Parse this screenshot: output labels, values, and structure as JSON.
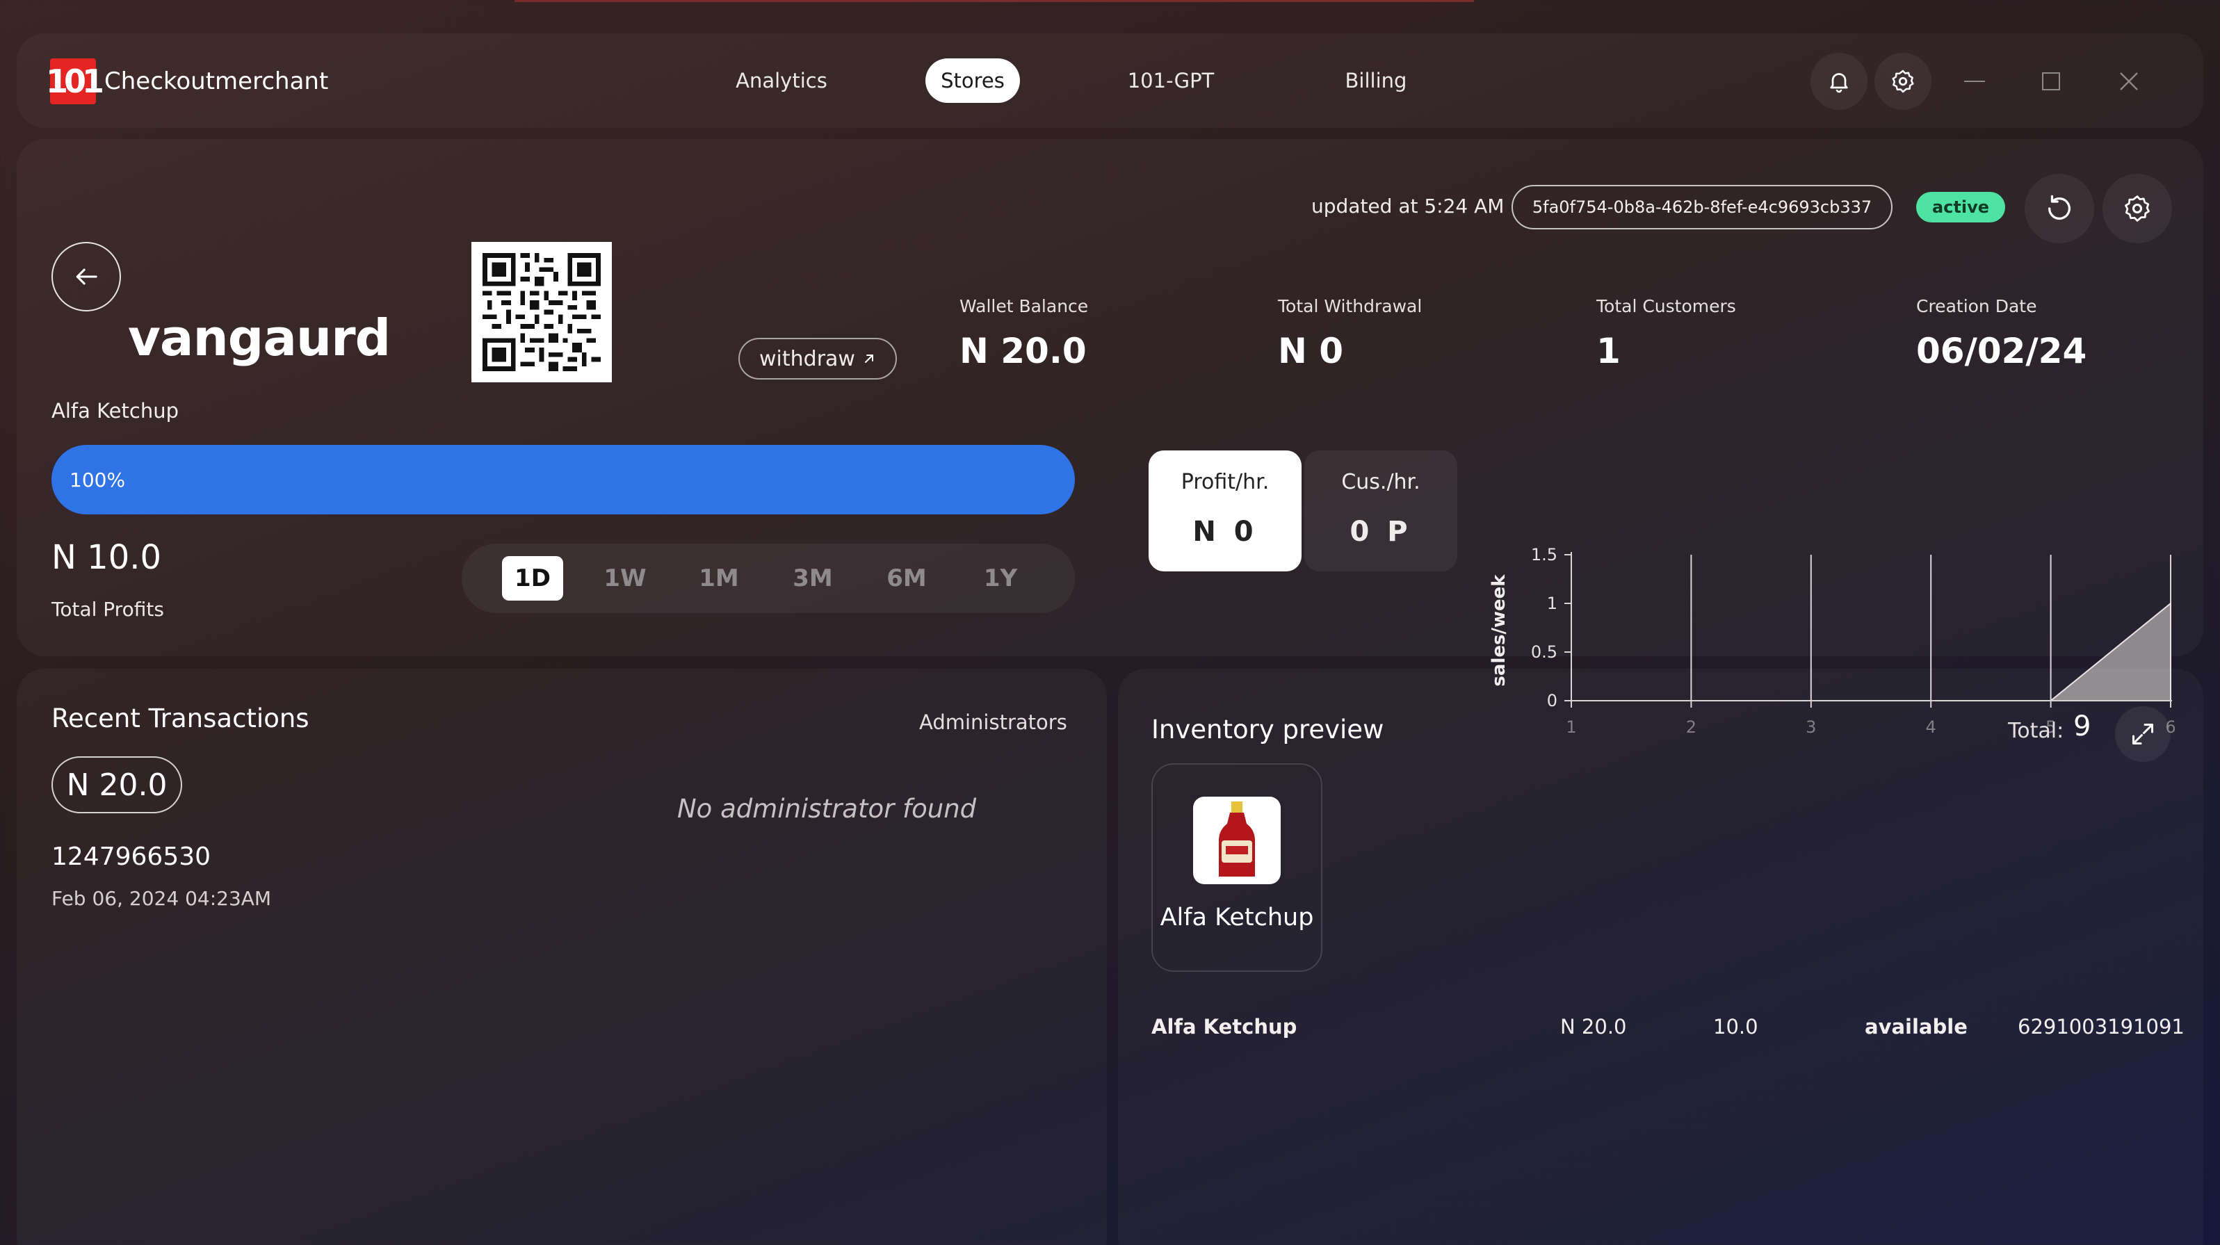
{
  "app": {
    "name": "Checkoutmerchant",
    "logo_text": "101"
  },
  "nav": {
    "items": [
      "Analytics",
      "Stores",
      "101-GPT",
      "Billing"
    ],
    "active": "Stores"
  },
  "store": {
    "name": "vangaurd",
    "product_label": "Alfa Ketchup",
    "withdraw_label": "withdraw",
    "updated_text": "updated at 5:24 AM",
    "store_id": "5fa0f754-0b8a-462b-8fef-e4c9693cb337",
    "status": "active",
    "progress": {
      "percent": 100,
      "label": "100%"
    },
    "profits": {
      "value": "N 10.0",
      "label": "Total Profits"
    },
    "ranges": [
      "1D",
      "1W",
      "1M",
      "3M",
      "6M",
      "1Y"
    ],
    "selected_range": "1D",
    "stats": [
      {
        "label": "Wallet Balance",
        "value": "N 20.0"
      },
      {
        "label": "Total Withdrawal",
        "value": "N 0"
      },
      {
        "label": "Total Customers",
        "value": "1"
      },
      {
        "label": "Creation Date",
        "value": "06/02/24"
      }
    ],
    "per_hour": [
      {
        "label": "Profit/hr.",
        "value": "N 0"
      },
      {
        "label": "Cus./hr.",
        "value": "0 P"
      }
    ]
  },
  "chart_data": {
    "type": "area",
    "x": [
      1,
      2,
      3,
      4,
      5,
      6
    ],
    "series": [
      {
        "values": [
          0,
          0,
          0,
          0,
          0,
          1
        ]
      }
    ],
    "ylabel": "sales/week",
    "xlabel": "",
    "yticks": [
      "0",
      "0.5",
      "1",
      "1.5"
    ],
    "xticks": [
      "1",
      "2",
      "3",
      "4",
      "5",
      "6"
    ],
    "ylim": [
      0,
      1.5
    ],
    "xlim": [
      1,
      6
    ],
    "grid": "vertical",
    "colors": {
      "area": "#8c8a8c",
      "axis": "#d9d4d4"
    }
  },
  "transactions": {
    "title": "Recent Transactions",
    "items": [
      {
        "amount": "N 20.0",
        "id": "1247966530",
        "date": "Feb 06, 2024 04:23AM"
      }
    ]
  },
  "administrators": {
    "title": "Administrators",
    "empty_text": "No administrator found"
  },
  "inventory": {
    "title": "Inventory preview",
    "total_label": "Total:",
    "total": "9",
    "cards": [
      {
        "name": "Alfa Ketchup"
      }
    ],
    "rows": [
      {
        "name": "Alfa Ketchup",
        "price": "N 20.0",
        "quantity": "10.0",
        "status": "available",
        "barcode": "6291003191091"
      }
    ]
  },
  "colors": {
    "accent": "#2f73e6",
    "status": "#4ee3a2",
    "logo": "#e52424"
  },
  "icons": [
    "bell-icon",
    "gear-icon",
    "minimize-icon",
    "maximize-icon",
    "close-icon",
    "back-arrow-icon",
    "refresh-icon",
    "expand-icon",
    "arrow-up-right-icon"
  ]
}
